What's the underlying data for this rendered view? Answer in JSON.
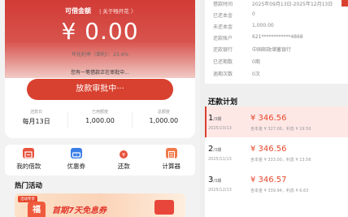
{
  "left": {
    "amount_label": "可借金额",
    "amount_switch": "| 关于畅开花 〉",
    "amount": "¥ 0.00",
    "rate_text": "年化利率（单利）：23.4%",
    "notice": "您有一笔借款正在审批中...",
    "pending_button": "放款审批中···",
    "stats": [
      {
        "label": "还款日",
        "value": "每月13日"
      },
      {
        "label": "已用额度",
        "value": "1,000.00"
      },
      {
        "label": "总额度",
        "value": "1,000.00"
      }
    ],
    "menu": [
      {
        "label": "我的借款",
        "icon": "loan-icon",
        "color": "#e8533d"
      },
      {
        "label": "优惠券",
        "icon": "coupon-icon",
        "color": "#3a7ee6"
      },
      {
        "label": "还款",
        "icon": "repay-icon",
        "color": "#e8533d"
      },
      {
        "label": "计算器",
        "icon": "calculator-icon",
        "color": "#f07a4b"
      }
    ],
    "hot_title": "热门活动",
    "banner": {
      "tag": "活动专享",
      "badge": "福",
      "title": "首期7天免息券"
    }
  },
  "right": {
    "details": [
      {
        "label": "借款时间",
        "value": "2025年09月13日-2025年12月13日"
      },
      {
        "label": "已还本金",
        "value": "0"
      },
      {
        "label": "未还本金",
        "value": "1,000.00"
      },
      {
        "label": "还款账户",
        "value": "621************4868"
      },
      {
        "label": "还款银行",
        "value": "中国邮政储蓄银行"
      },
      {
        "label": "已还期数",
        "value": "0期"
      },
      {
        "label": "逾期次数",
        "value": "0次"
      }
    ],
    "plan_title": "还款计划",
    "plan": [
      {
        "period": "1",
        "unit": "/3期",
        "date": "2025/10/13",
        "amount": "¥ 346.56",
        "sub": "含本金 ¥ 327.06，利息 ¥ 19.50"
      },
      {
        "period": "2",
        "unit": "/3期",
        "date": "2025/11/13",
        "amount": "¥ 346.56",
        "sub": "含本金 ¥ 333.00，利息 ¥ 13.56"
      },
      {
        "period": "3",
        "unit": "/3期",
        "date": "2025/12/13",
        "amount": "¥ 346.57",
        "sub": "含本金 ¥ 339.94，利息 ¥ 6.63"
      }
    ]
  }
}
